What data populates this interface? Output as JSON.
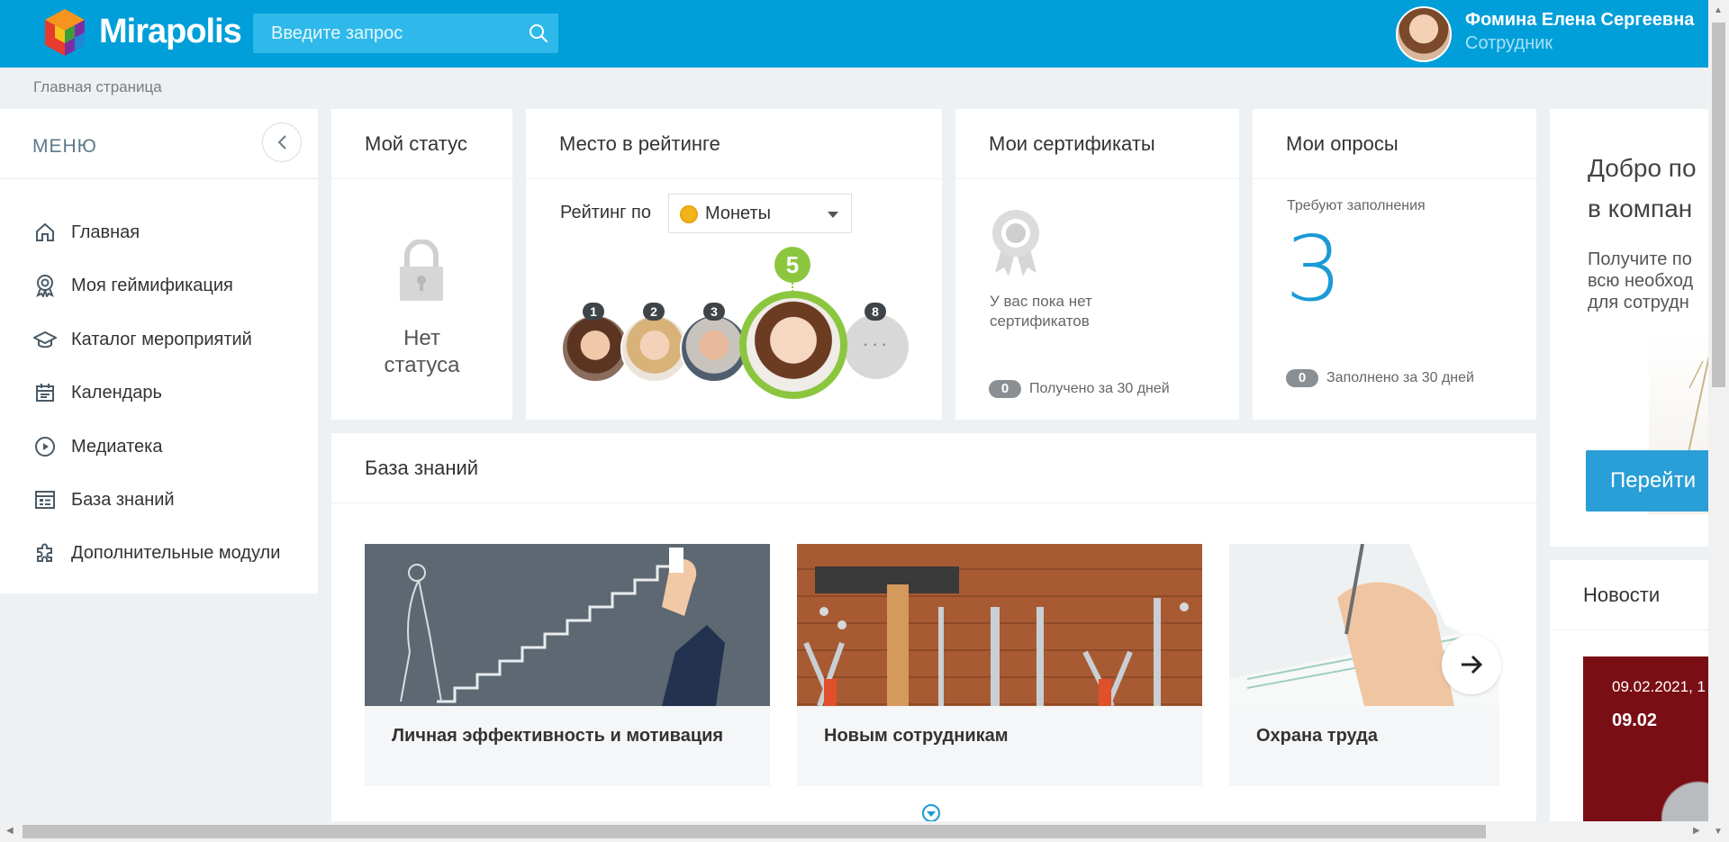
{
  "header": {
    "logo_text": "Mirapolis",
    "search_placeholder": "Введите запрос",
    "user_name": "Фомина Елена Сергеевна",
    "user_role": "Сотрудник"
  },
  "breadcrumb": "Главная страница",
  "menu": {
    "title": "МЕНЮ",
    "items": [
      {
        "label": "Главная",
        "icon": "home-icon"
      },
      {
        "label": "Моя геймификация",
        "icon": "medal-icon"
      },
      {
        "label": "Каталог мероприятий",
        "icon": "graduation-cap-icon"
      },
      {
        "label": "Календарь",
        "icon": "calendar-icon"
      },
      {
        "label": "Медиатека",
        "icon": "play-icon"
      },
      {
        "label": "База знаний",
        "icon": "knowledge-base-icon"
      },
      {
        "label": "Дополнительные модули",
        "icon": "puzzle-icon"
      }
    ]
  },
  "status_card": {
    "title": "Мой статус",
    "line1": "Нет",
    "line2": "статуса"
  },
  "rating_card": {
    "title": "Место в рейтинге",
    "rating_by": "Рейтинг по",
    "selected": "Монеты",
    "my_place": "5",
    "places": [
      "1",
      "2",
      "3",
      "8"
    ],
    "more": "···"
  },
  "cert_card": {
    "title": "Мои сертификаты",
    "empty": "У вас пока нет сертификатов",
    "count": "0",
    "note": "Получено за 30 дней"
  },
  "survey_card": {
    "title": "Мои опросы",
    "required_label": "Требуют заполнения",
    "required_count": "3",
    "count": "0",
    "note": "Заполнено за 30 дней"
  },
  "welcome_card": {
    "title_line1": "Добро по",
    "title_line2": "в компан",
    "text_line1": "Получите по",
    "text_line2": "всю необход",
    "text_line3": "для сотрудн",
    "button": "Перейти"
  },
  "news_card": {
    "title": "Новости",
    "date_line1": "09.02.2021, 1",
    "date_line2": "09.02"
  },
  "kb_card": {
    "title": "База знаний",
    "tiles": [
      {
        "label": "Личная эффективность и мотивация"
      },
      {
        "label": "Новым сотрудникам"
      },
      {
        "label": "Охрана труда"
      }
    ]
  },
  "colors": {
    "header": "#009fd9",
    "accent_green": "#8cc63f",
    "accent_blue": "#2a9ed6"
  }
}
